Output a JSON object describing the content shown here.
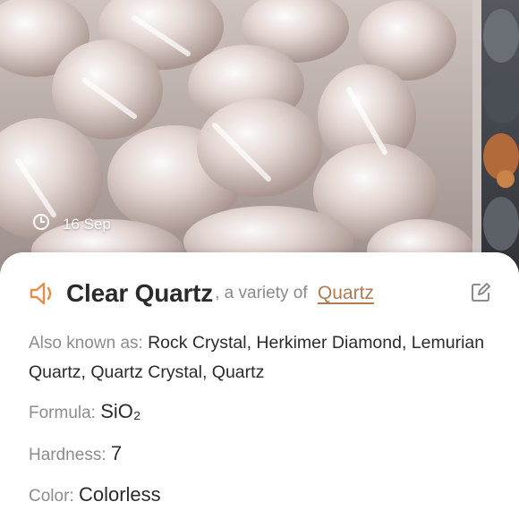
{
  "photo": {
    "date": "16 Sep",
    "icon": "clock-icon"
  },
  "mineral": {
    "name": "Clear Quartz",
    "variety_prefix": ", a variety of ",
    "parent": "Quartz",
    "speaker_icon": "speaker-icon",
    "edit_icon": "edit-icon",
    "accent_color": "#e88a4c",
    "link_color": "#b07a52"
  },
  "properties": {
    "aka_label": "Also known as: ",
    "aka_value": "Rock Crystal, Herkimer Diamond, Lemurian Quartz, Quartz Crystal, Quartz",
    "formula_label": "Formula: ",
    "formula_value": "SiO₂",
    "hardness_label": "Hardness: ",
    "hardness_value": "7",
    "color_label": "Color: ",
    "color_value": "Colorless"
  }
}
